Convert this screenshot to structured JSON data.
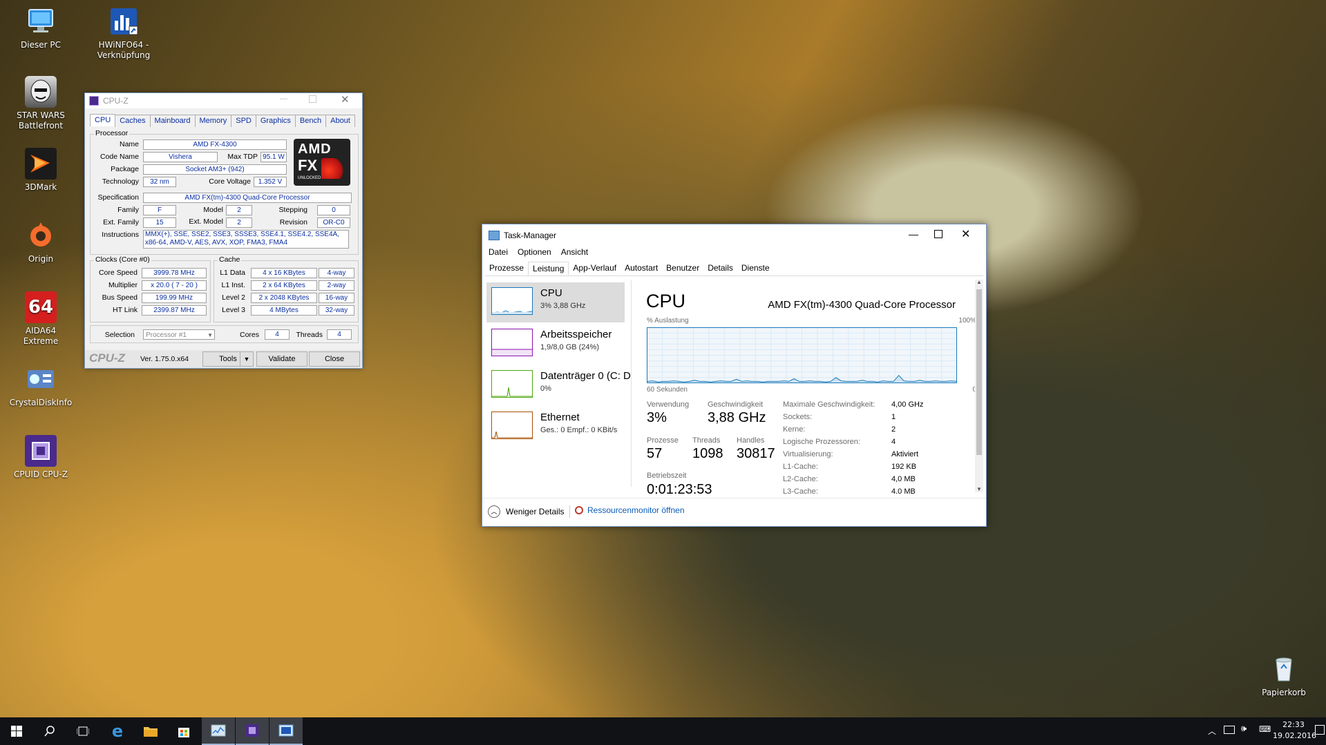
{
  "desktop": {
    "icons": [
      {
        "label": "Dieser PC",
        "icon": "computer-icon"
      },
      {
        "label": "HWiNFO64 - Verknüpfung",
        "icon": "hwinfo-icon"
      },
      {
        "label": "STAR WARS Battlefront",
        "icon": "starwars-icon"
      },
      {
        "label": "3DMark",
        "icon": "3dmark-icon"
      },
      {
        "label": "Origin",
        "icon": "origin-icon"
      },
      {
        "label": "AIDA64 Extreme",
        "icon": "aida64-icon"
      },
      {
        "label": "CrystalDiskInfo",
        "icon": "crystaldiskinfo-icon"
      },
      {
        "label": "CPUID CPU-Z",
        "icon": "cpuz-icon"
      },
      {
        "label": "Papierkorb",
        "icon": "recycle-bin-icon"
      }
    ]
  },
  "cpuz": {
    "title": "CPU-Z",
    "tabs": [
      "CPU",
      "Caches",
      "Mainboard",
      "Memory",
      "SPD",
      "Graphics",
      "Bench",
      "About"
    ],
    "processor_group": "Processor",
    "labels": {
      "name": "Name",
      "code_name": "Code Name",
      "max_tdp": "Max TDP",
      "package": "Package",
      "technology": "Technology",
      "core_voltage": "Core Voltage",
      "specification": "Specification",
      "family": "Family",
      "model": "Model",
      "stepping": "Stepping",
      "ext_family": "Ext. Family",
      "ext_model": "Ext. Model",
      "revision": "Revision",
      "instructions": "Instructions",
      "core_speed": "Core Speed",
      "multiplier": "Multiplier",
      "bus_speed": "Bus Speed",
      "ht_link": "HT Link",
      "l1_data": "L1 Data",
      "l1_inst": "L1 Inst.",
      "level2": "Level 2",
      "level3": "Level 3",
      "selection": "Selection",
      "cores": "Cores",
      "threads": "Threads"
    },
    "values": {
      "name": "AMD FX-4300",
      "code_name": "Vishera",
      "max_tdp": "95.1 W",
      "package": "Socket AM3+ (942)",
      "technology": "32 nm",
      "core_voltage": "1.352 V",
      "specification": "AMD FX(tm)-4300 Quad-Core Processor",
      "family": "F",
      "model": "2",
      "stepping": "0",
      "ext_family": "15",
      "ext_model": "2",
      "revision": "OR-C0",
      "instructions_1": "MMX(+), SSE, SSE2, SSE3, SSSE3, SSE4.1, SSE4.2, SSE4A,",
      "instructions_2": "x86-64, AMD-V, AES, AVX, XOP, FMA3, FMA4",
      "core_speed": "3999.78 MHz",
      "multiplier": "x 20.0 ( 7 - 20 )",
      "bus_speed": "199.99 MHz",
      "ht_link": "2399.87 MHz",
      "l1_data": "4 x 16 KBytes",
      "l1_data_way": "4-way",
      "l1_inst": "2 x 64 KBytes",
      "l1_inst_way": "2-way",
      "level2": "2 x 2048 KBytes",
      "level2_way": "16-way",
      "level3": "4 MBytes",
      "level3_way": "32-way",
      "selection": "Processor #1",
      "cores": "4",
      "threads": "4"
    },
    "clocks_group": "Clocks (Core #0)",
    "cache_group": "Cache",
    "logo_text": "AMD",
    "logo_sub": "FX",
    "logo_small": "UNLOCKED",
    "footer": {
      "brand": "CPU-Z",
      "version": "Ver. 1.75.0.x64",
      "tools": "Tools",
      "validate": "Validate",
      "close": "Close"
    }
  },
  "taskmanager": {
    "title": "Task-Manager",
    "menu": [
      "Datei",
      "Optionen",
      "Ansicht"
    ],
    "tabs": [
      "Prozesse",
      "Leistung",
      "App-Verlauf",
      "Autostart",
      "Benutzer",
      "Details",
      "Dienste"
    ],
    "sidebar": [
      {
        "name": "CPU",
        "sub": "3% 3,88 GHz",
        "color": "#1779ba"
      },
      {
        "name": "Arbeitsspeicher",
        "sub": "1,9/8,0 GB (24%)",
        "color": "#8b12ae"
      },
      {
        "name": "Datenträger 0 (C: D",
        "sub": "0%",
        "color": "#4da60c"
      },
      {
        "name": "Ethernet",
        "sub": "Ges.: 0 Empf.: 0 KBit/s",
        "color": "#a74f01"
      }
    ],
    "detail": {
      "heading": "CPU",
      "processor": "AMD FX(tm)-4300 Quad-Core Processor",
      "graph_top_left": "% Auslastung",
      "graph_top_right": "100%",
      "graph_bottom_left": "60 Sekunden",
      "graph_bottom_right": "0",
      "usage_series": [
        2,
        3,
        1,
        2,
        2,
        3,
        2,
        1,
        2,
        4,
        2,
        2,
        1,
        2,
        3,
        2,
        2,
        6,
        2,
        3,
        2,
        2,
        1,
        2,
        2,
        2,
        3,
        2,
        7,
        2,
        2,
        3,
        2,
        2,
        1,
        2,
        9,
        3,
        2,
        2,
        2,
        4,
        2,
        2,
        1,
        3,
        2,
        2,
        13,
        3,
        2,
        2,
        4,
        2,
        2,
        3,
        2,
        2,
        3,
        2
      ],
      "stats": {
        "verwendung_label": "Verwendung",
        "verwendung": "3%",
        "geschwindigkeit_label": "Geschwindigkeit",
        "geschwindigkeit": "3,88 GHz",
        "prozesse_label": "Prozesse",
        "prozesse": "57",
        "threads_label": "Threads",
        "threads": "1098",
        "handles_label": "Handles",
        "handles": "30817",
        "betriebszeit_label": "Betriebszeit",
        "betriebszeit": "0:01:23:53"
      },
      "specs": [
        {
          "k": "Maximale Geschwindigkeit:",
          "v": "4,00 GHz"
        },
        {
          "k": "Sockets:",
          "v": "1"
        },
        {
          "k": "Kerne:",
          "v": "2"
        },
        {
          "k": "Logische Prozessoren:",
          "v": "4"
        },
        {
          "k": "Virtualisierung:",
          "v": "Aktiviert"
        },
        {
          "k": "L1-Cache:",
          "v": "192 KB"
        },
        {
          "k": "L2-Cache:",
          "v": "4,0 MB"
        },
        {
          "k": "L3-Cache:",
          "v": "4,0 MB"
        }
      ]
    },
    "footer": {
      "less": "Weniger Details",
      "resmon": "Ressourcenmonitor öffnen"
    }
  },
  "taskbar": {
    "time": "22:33",
    "date": "19.02.2016"
  }
}
